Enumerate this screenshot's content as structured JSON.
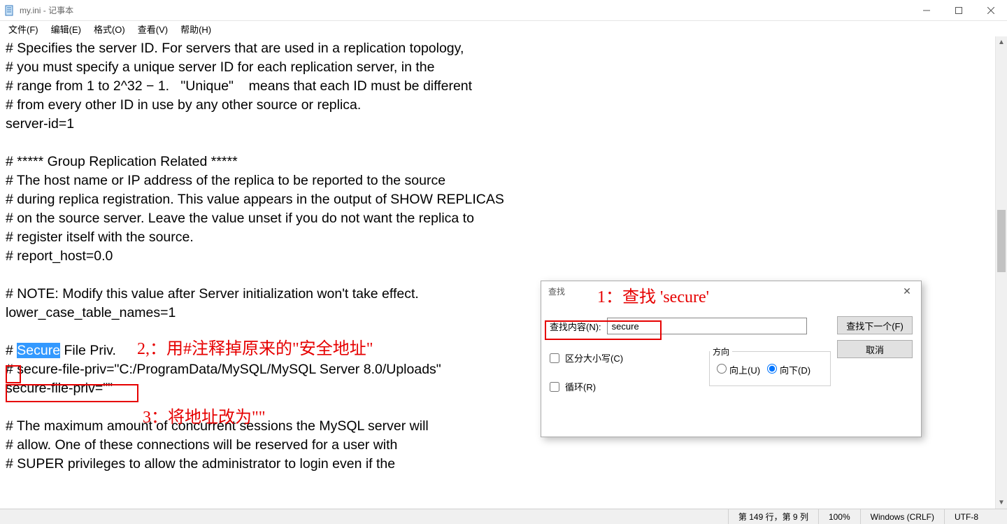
{
  "window": {
    "title": "my.ini - 记事本"
  },
  "menu": {
    "file": "文件(F)",
    "edit": "编辑(E)",
    "format": "格式(O)",
    "view": "查看(V)",
    "help": "帮助(H)"
  },
  "editor": {
    "l01": "# Specifies the server ID. For servers that are used in a replication topology,",
    "l02": "# you must specify a unique server ID for each replication server, in the",
    "l03": "# range from 1 to 2^32 − 1.   \"Unique\"    means that each ID must be different",
    "l04": "# from every other ID in use by any other source or replica.",
    "l05": "server-id=1",
    "l06": "",
    "l07": "# ***** Group Replication Related *****",
    "l08": "# The host name or IP address of the replica to be reported to the source",
    "l09": "# during replica registration. This value appears in the output of SHOW REPLICAS",
    "l10": "# on the source server. Leave the value unset if you do not want the replica to",
    "l11": "# register itself with the source.",
    "l12": "# report_host=0.0",
    "l13": "",
    "l14": "# NOTE: Modify this value after Server initialization won't take effect.",
    "l15": "lower_case_table_names=1",
    "l16": "",
    "l17a": "# ",
    "l17b": "Secure",
    "l17c": " File Priv.",
    "l18": "# secure-file-priv=\"C:/ProgramData/MySQL/MySQL Server 8.0/Uploads\"",
    "l19": "secure-file-priv=\"\"",
    "l20": "",
    "l21": "# The maximum amount of concurrent sessions the MySQL server will",
    "l22": "# allow. One of these connections will be reserved for a user with",
    "l23": "# SUPER privileges to allow the administrator to login even if the"
  },
  "find": {
    "title": "查找",
    "content_label": "查找内容(N):",
    "content_value": "secure",
    "next_btn": "查找下一个(F)",
    "cancel_btn": "取消",
    "match_case": "区分大小写(C)",
    "wrap": "循环(R)",
    "dir_label": "方向",
    "dir_up": "向上(U)",
    "dir_down": "向下(D)"
  },
  "status": {
    "pos": "第 149 行，第 9 列",
    "zoom": "100%",
    "eol": "Windows (CRLF)",
    "enc": "UTF-8"
  },
  "annotations": {
    "a1": "1：查找 'secure'",
    "a2": "2,：用#注释掉原来的\"安全地址\"",
    "a3": "3：将地址改为\"\""
  }
}
